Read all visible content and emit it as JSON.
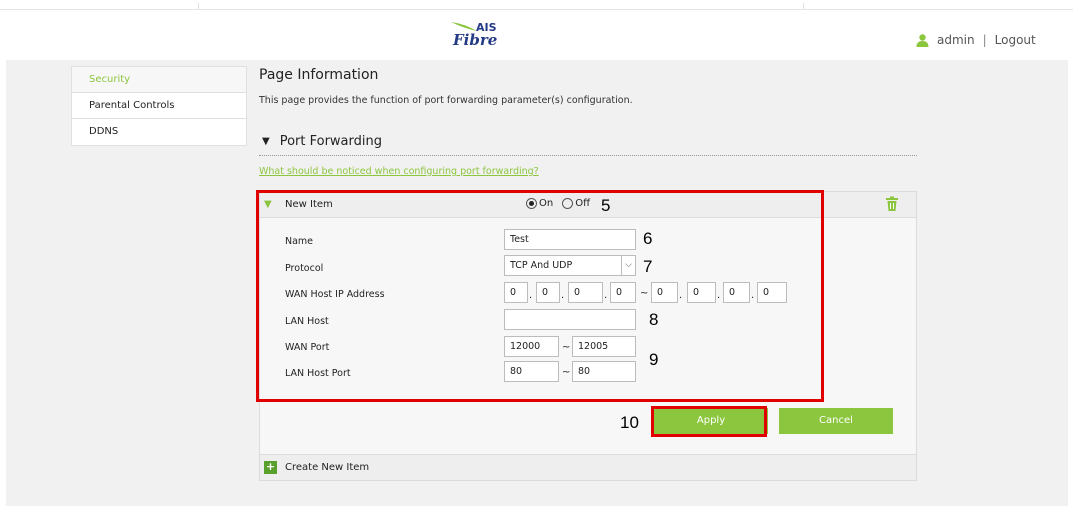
{
  "header": {
    "logo_ais": "AIS",
    "logo_fibre": "Fibre",
    "user": "admin",
    "separator": "|",
    "logout": "Logout"
  },
  "sidebar": {
    "items": [
      {
        "label": "Security",
        "active": true
      },
      {
        "label": "Parental Controls",
        "active": false
      },
      {
        "label": "DDNS",
        "active": false
      }
    ]
  },
  "main": {
    "title": "Page Information",
    "description": "This page provides the function of port forwarding parameter(s) configuration.",
    "section_title": "Port Forwarding",
    "help_link": "What should be noticed when configuring port forwarding?"
  },
  "panel": {
    "item_label": "New Item",
    "on_label": "On",
    "off_label": "Off",
    "status": "on",
    "fields": {
      "name_label": "Name",
      "name_value": "Test",
      "protocol_label": "Protocol",
      "protocol_value": "TCP And UDP",
      "wan_ip_label": "WAN Host IP Address",
      "wan_ip_start": [
        "0",
        "0",
        "0",
        "0"
      ],
      "wan_ip_end": [
        "0",
        "0",
        "0",
        "0"
      ],
      "lan_host_label": "LAN Host",
      "lan_host_value": "",
      "wan_port_label": "WAN Port",
      "wan_port_start": "12000",
      "wan_port_end": "12005",
      "lan_port_label": "LAN Host Port",
      "lan_port_start": "80",
      "lan_port_end": "80"
    },
    "apply_label": "Apply",
    "cancel_label": "Cancel",
    "create_label": "Create New Item"
  },
  "annotations": {
    "n5": "5",
    "n6": "6",
    "n7": "7",
    "n8": "8",
    "n9": "9",
    "n10": "10"
  },
  "colors": {
    "accent": "#8cc63f",
    "highlight": "#e00000",
    "brand": "#233a84"
  },
  "icons": {
    "user": "user-icon",
    "trash": "trash-icon",
    "plus": "plus-icon",
    "collapse": "triangle-down-icon",
    "dropdown": "chevron-down-icon"
  }
}
